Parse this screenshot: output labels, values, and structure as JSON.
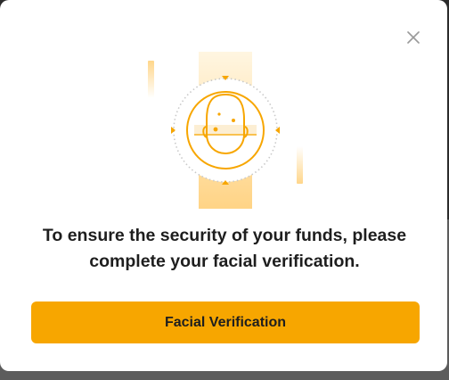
{
  "dialog": {
    "headline_line1": "To ensure the security of your funds, please",
    "headline_line2": "complete your facial verification.",
    "primary_button_label": "Facial Verification",
    "close_icon": "close-icon",
    "illustration_icon": "face-scan-icon"
  },
  "colors": {
    "accent": "#f7a600",
    "text": "#1e1e1e",
    "close_icon": "#9a9a9a",
    "overlay": "#2b2b2b"
  }
}
